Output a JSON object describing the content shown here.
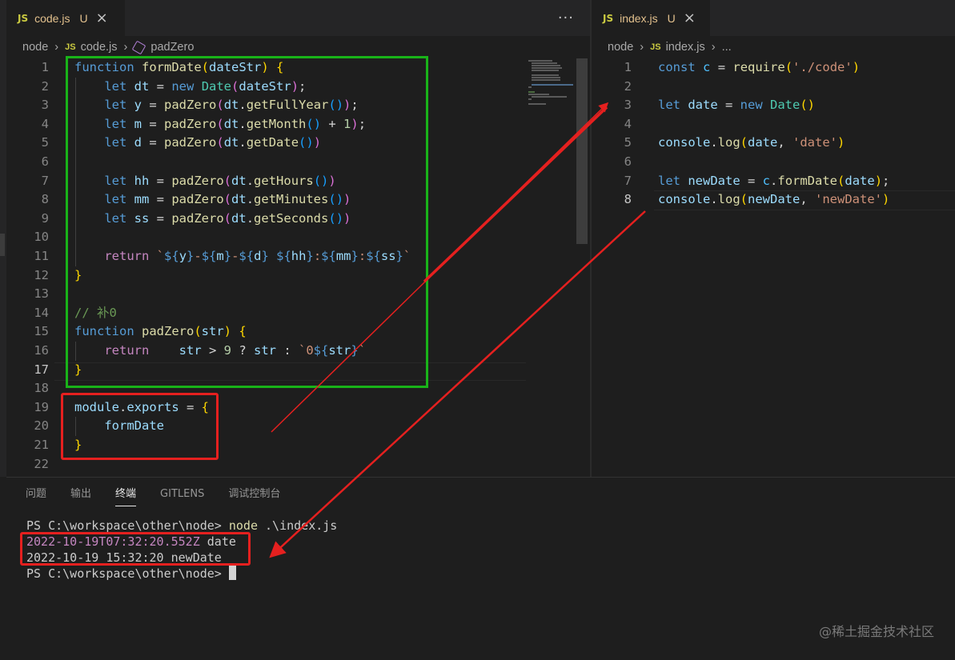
{
  "left_editor": {
    "tab": {
      "icon": "JS",
      "name": "code.js",
      "status": "U",
      "close": "×",
      "more": "···"
    },
    "breadcrumb": {
      "folder": "node",
      "file_icon": "JS",
      "file": "code.js",
      "symbol": "padZero"
    },
    "line_numbers": [
      "1",
      "2",
      "3",
      "4",
      "5",
      "6",
      "7",
      "8",
      "9",
      "10",
      "11",
      "12",
      "13",
      "14",
      "15",
      "16",
      "17",
      "18",
      "19",
      "20",
      "21",
      "22"
    ],
    "active_line": "17"
  },
  "right_editor": {
    "tab": {
      "icon": "JS",
      "name": "index.js",
      "status": "U",
      "close": "×"
    },
    "breadcrumb": {
      "folder": "node",
      "file_icon": "JS",
      "file": "index.js",
      "symbol": "..."
    },
    "line_numbers": [
      "1",
      "2",
      "3",
      "4",
      "5",
      "6",
      "7",
      "8"
    ],
    "active_line": "8"
  },
  "panel": {
    "tabs": [
      "问题",
      "输出",
      "终端",
      "GITLENS",
      "调试控制台"
    ],
    "active_tab": "终端",
    "terminal": {
      "prompt": "PS C:\\workspace\\other\\node>",
      "command": "node",
      "command_arg": ".\\index.js",
      "output_date_value": "2022-10-19T07:32:20.552Z",
      "output_date_label": "date",
      "output_newdate_value": "2022-10-19 15:32:20",
      "output_newdate_label": "newDate",
      "prompt2": "PS C:\\workspace\\other\\node>"
    }
  },
  "watermark": "@稀土掘金技术社区",
  "annotation_colors": {
    "green_box": "#19b319",
    "red": "#e5201f"
  }
}
